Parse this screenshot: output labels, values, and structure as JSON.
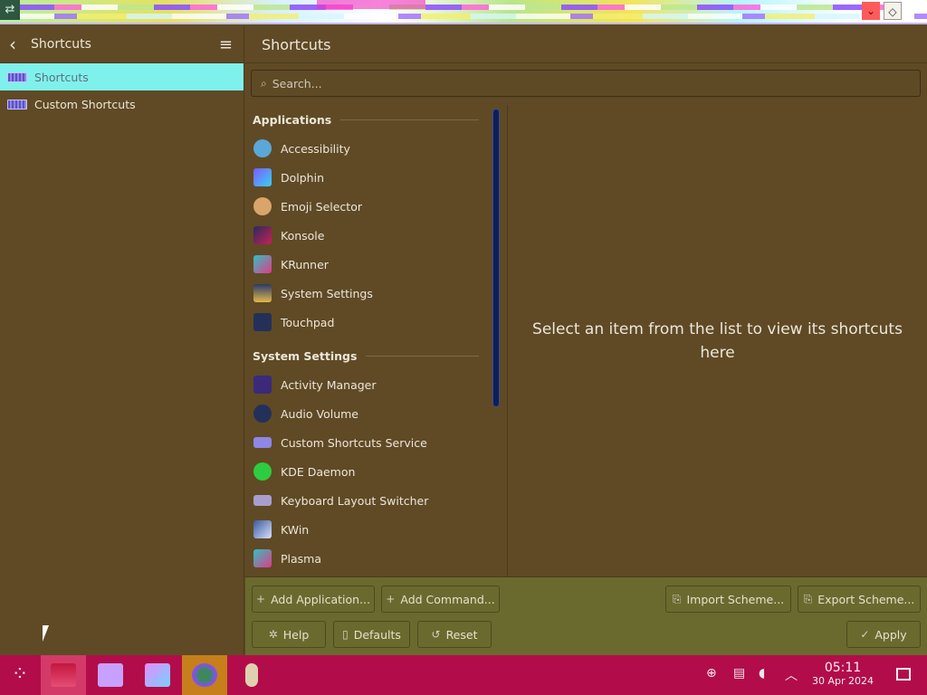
{
  "sidebar": {
    "title": "Shortcuts",
    "items": [
      {
        "label": "Shortcuts"
      },
      {
        "label": "Custom Shortcuts"
      }
    ]
  },
  "main": {
    "title": "Shortcuts",
    "search_placeholder": "Search...",
    "sections": [
      {
        "title": "Applications",
        "items": [
          {
            "label": "Accessibility",
            "icon": "accessibility-icon"
          },
          {
            "label": "Dolphin",
            "icon": "folder-icon"
          },
          {
            "label": "Emoji Selector",
            "icon": "emoji-icon"
          },
          {
            "label": "Konsole",
            "icon": "terminal-icon"
          },
          {
            "label": "KRunner",
            "icon": "krunner-icon"
          },
          {
            "label": "System Settings",
            "icon": "settings-icon"
          },
          {
            "label": "Touchpad",
            "icon": "touchpad-icon"
          }
        ]
      },
      {
        "title": "System Settings",
        "items": [
          {
            "label": "Activity Manager",
            "icon": "activity-icon"
          },
          {
            "label": "Audio Volume",
            "icon": "speaker-icon"
          },
          {
            "label": "Custom Shortcuts Service",
            "icon": "keyboard-icon"
          },
          {
            "label": "KDE Daemon",
            "icon": "daemon-icon"
          },
          {
            "label": "Keyboard Layout Switcher",
            "icon": "keyboard-icon"
          },
          {
            "label": "KWin",
            "icon": "window-icon"
          },
          {
            "label": "Plasma",
            "icon": "plasma-icon"
          }
        ]
      }
    ],
    "detail_message": "Select an item from the list to view its shortcuts here"
  },
  "footer": {
    "add_application": "Add Application...",
    "add_command": "Add Command...",
    "import_scheme": "Import Scheme...",
    "export_scheme": "Export Scheme...",
    "help": "Help",
    "defaults": "Defaults",
    "reset": "Reset",
    "apply": "Apply"
  },
  "taskbar": {
    "time": "05:11",
    "date": "30 Apr 2024"
  },
  "colors": {
    "background": "#5f4a25",
    "selected": "#7ff1ec",
    "footer": "#6a6a2e",
    "taskbar": "#b20d4a",
    "scrollbar": "#0f1e5a"
  }
}
